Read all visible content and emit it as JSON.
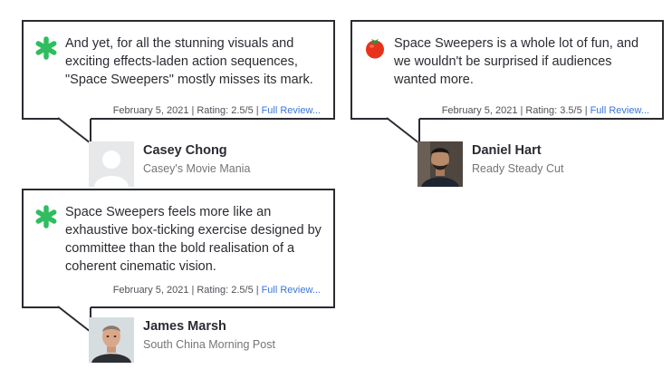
{
  "reviews": [
    {
      "icon": "green-splat-rotten-icon",
      "quote": "And yet, for all the stunning visuals and exciting effects-laden action sequences, \"Space Sweepers\" mostly misses its mark.",
      "date": "February 5, 2021",
      "rating": "Rating: 2.5/5",
      "link": "Full Review...",
      "critic": "Casey Chong",
      "publication": "Casey's Movie Mania"
    },
    {
      "icon": "red-tomato-fresh-icon",
      "quote": "Space Sweepers is a whole lot of fun, and we wouldn't be surprised if audiences wanted more.",
      "date": "February 5, 2021",
      "rating": "Rating: 3.5/5",
      "link": "Full Review...",
      "critic": "Daniel Hart",
      "publication": "Ready Steady Cut"
    },
    {
      "icon": "green-splat-rotten-icon",
      "quote": "Space Sweepers feels more like an exhaustive box-ticking exercise designed by committee than the bold realisation of a coherent cinematic vision.",
      "date": "February 5, 2021",
      "rating": "Rating: 2.5/5",
      "link": "Full Review...",
      "critic": "James Marsh",
      "publication": "South China Morning Post"
    }
  ],
  "colors": {
    "rotten_green": "#2fbd5f",
    "fresh_red": "#e8321c",
    "link_blue": "#3976dc",
    "border": "#2a2c32"
  }
}
